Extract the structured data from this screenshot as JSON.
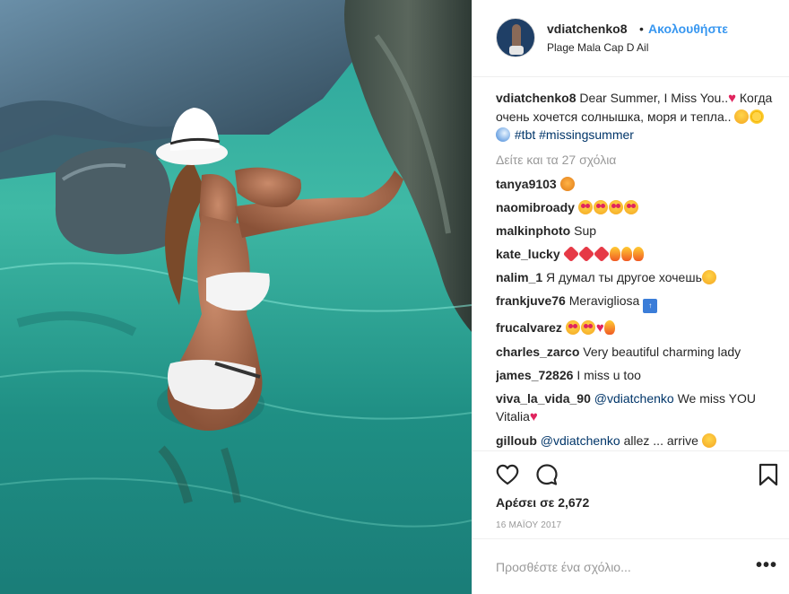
{
  "post": {
    "header": {
      "username": "vdiatchenko8",
      "separator": "•",
      "follow_label": "Ακολουθήστε",
      "location": "Plage Mala Cap D Ail"
    },
    "caption": {
      "username": "vdiatchenko8",
      "text_line1": "Dear Summer, I Miss You..",
      "text_line2": "Когда очень хочется солнышка, моря и тепла..",
      "hashtags": "#tbt #missingsummer"
    },
    "view_all_comments": "Δείτε και τα 27 σχόλια",
    "comments": [
      {
        "user": "tanya9103",
        "text": ""
      },
      {
        "user": "naomibroady",
        "text": ""
      },
      {
        "user": "malkinphoto",
        "text": "Sup"
      },
      {
        "user": "kate_lucky",
        "text": ""
      },
      {
        "user": "nalim_1",
        "text": "Я думал ты другое хочешь"
      },
      {
        "user": "frankjuve76",
        "text": "Meravigliosa"
      },
      {
        "user": "frucalvarez",
        "text": ""
      },
      {
        "user": "charles_zarco",
        "text": "Very beautiful charming lady"
      },
      {
        "user": "james_72826",
        "text": "I miss u too"
      },
      {
        "user": "viva_la_vida_90",
        "mention": "@vdiatchenko",
        "text": "We miss YOU Vitalia"
      },
      {
        "user": "gilloub",
        "mention": "@vdiatchenko",
        "text": "allez ... arrive"
      }
    ],
    "likes": "Αρέσει σε 2,672",
    "date": "16 ΜΑΪΟΥ 2017",
    "add_comment_placeholder": "Προσθέστε ένα σχόλιο...",
    "more_options": "•••"
  },
  "icons": {
    "like": "heart-icon",
    "comment": "comment-icon",
    "save": "bookmark-icon"
  },
  "colors": {
    "link_blue": "#3897f0",
    "hashtag": "#003569",
    "muted": "#999999",
    "border": "#efefef"
  }
}
